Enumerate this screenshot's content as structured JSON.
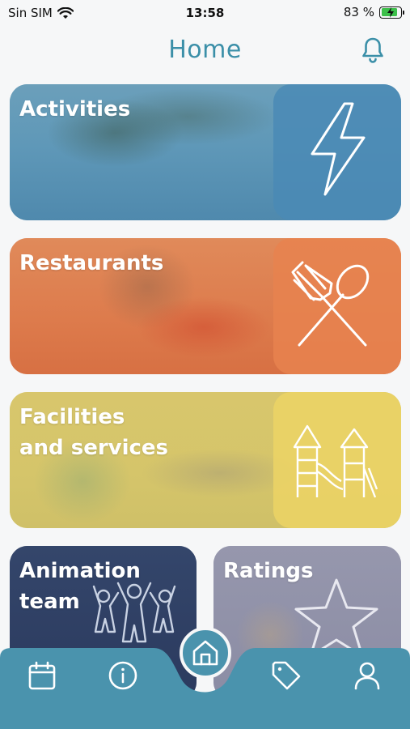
{
  "status_bar": {
    "carrier": "Sin SIM",
    "time": "13:58",
    "battery": "83 %",
    "battery_level": 0.83,
    "icons": [
      "wifi-icon",
      "battery-charging-icon"
    ]
  },
  "header": {
    "title": "Home",
    "icons": [
      "bell-icon"
    ]
  },
  "cards": [
    {
      "label": "Activities",
      "icon": "lightning-icon",
      "color": "#5a97b7"
    },
    {
      "label": "Restaurants",
      "icon": "fork-spoon-icon",
      "color": "#de7a4b"
    },
    {
      "label_line1": "Facilities",
      "label_line2": "and services",
      "icon": "playground-icon",
      "color": "#d8c86a"
    },
    {
      "label_line1": "Animation",
      "label_line2": "team",
      "icon": "people-icon",
      "color": "#2f3e62"
    },
    {
      "label": "Ratings",
      "icon": "star-icon",
      "color": "#8e8fa7"
    }
  ],
  "tab_bar": {
    "color": "#4a93ad",
    "items": [
      "calendar-icon",
      "info-icon",
      "home-icon",
      "tag-icon",
      "user-icon"
    ],
    "active": "home-icon"
  }
}
